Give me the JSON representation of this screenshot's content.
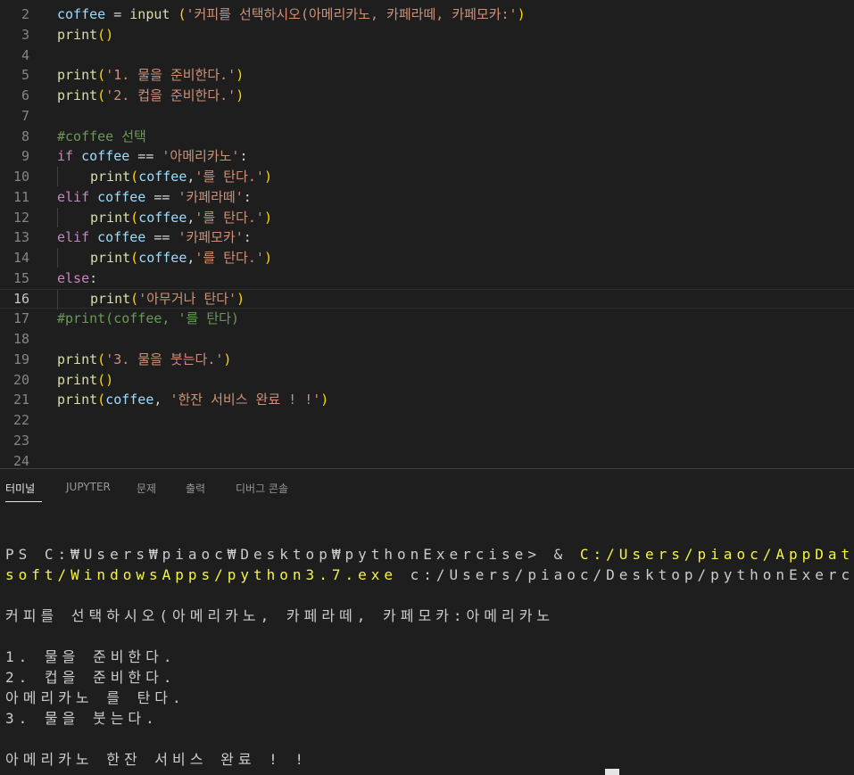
{
  "editor": {
    "lines": [
      {
        "n": "2",
        "tokens": [
          [
            "var",
            "coffee"
          ],
          [
            "pl",
            " = "
          ],
          [
            "fn",
            "input"
          ],
          [
            "pl",
            " "
          ],
          [
            "br1",
            "("
          ],
          [
            "str",
            "'커피를 선택하시오(아메리카노, 카페라떼, 카페모카:'"
          ],
          [
            "br1",
            ")"
          ]
        ]
      },
      {
        "n": "3",
        "tokens": [
          [
            "fn",
            "print"
          ],
          [
            "br1",
            "()"
          ]
        ]
      },
      {
        "n": "4",
        "tokens": []
      },
      {
        "n": "5",
        "tokens": [
          [
            "fn",
            "print"
          ],
          [
            "br1",
            "("
          ],
          [
            "str",
            "'1. 물을 준비한다.'"
          ],
          [
            "br1",
            ")"
          ]
        ]
      },
      {
        "n": "6",
        "tokens": [
          [
            "fn",
            "print"
          ],
          [
            "br1",
            "("
          ],
          [
            "str",
            "'2. 컵을 준비한다.'"
          ],
          [
            "br1",
            ")"
          ]
        ]
      },
      {
        "n": "7",
        "tokens": []
      },
      {
        "n": "8",
        "tokens": [
          [
            "cmt",
            "#coffee 선택"
          ]
        ]
      },
      {
        "n": "9",
        "tokens": [
          [
            "kw",
            "if"
          ],
          [
            "pl",
            " "
          ],
          [
            "var",
            "coffee"
          ],
          [
            "pl",
            " == "
          ],
          [
            "str",
            "'아메리카노'"
          ],
          [
            "pl",
            ":"
          ]
        ]
      },
      {
        "n": "10",
        "indent": true,
        "tokens": [
          [
            "fn",
            "print"
          ],
          [
            "br1",
            "("
          ],
          [
            "var",
            "coffee"
          ],
          [
            "pl",
            ","
          ],
          [
            "str",
            "'를 탄다.'"
          ],
          [
            "br1",
            ")"
          ]
        ]
      },
      {
        "n": "11",
        "tokens": [
          [
            "kw",
            "elif"
          ],
          [
            "pl",
            " "
          ],
          [
            "var",
            "coffee"
          ],
          [
            "pl",
            " == "
          ],
          [
            "str",
            "'카페라떼'"
          ],
          [
            "pl",
            ":"
          ]
        ]
      },
      {
        "n": "12",
        "indent": true,
        "tokens": [
          [
            "fn",
            "print"
          ],
          [
            "br1",
            "("
          ],
          [
            "var",
            "coffee"
          ],
          [
            "pl",
            ","
          ],
          [
            "str",
            "'를 탄다.'"
          ],
          [
            "br1",
            ")"
          ]
        ]
      },
      {
        "n": "13",
        "tokens": [
          [
            "kw",
            "elif"
          ],
          [
            "pl",
            " "
          ],
          [
            "var",
            "coffee"
          ],
          [
            "pl",
            " == "
          ],
          [
            "str",
            "'카페모카'"
          ],
          [
            "pl",
            ":"
          ]
        ]
      },
      {
        "n": "14",
        "indent": true,
        "tokens": [
          [
            "fn",
            "print"
          ],
          [
            "br1",
            "("
          ],
          [
            "var",
            "coffee"
          ],
          [
            "pl",
            ","
          ],
          [
            "str",
            "'를 탄다.'"
          ],
          [
            "br1",
            ")"
          ]
        ]
      },
      {
        "n": "15",
        "tokens": [
          [
            "kw",
            "else"
          ],
          [
            "pl",
            ":"
          ]
        ]
      },
      {
        "n": "16",
        "indent": true,
        "current": true,
        "tokens": [
          [
            "fn",
            "print"
          ],
          [
            "br1",
            "("
          ],
          [
            "str",
            "'아무거나 탄다'"
          ],
          [
            "br1",
            ")"
          ]
        ]
      },
      {
        "n": "17",
        "tokens": [
          [
            "cmt",
            "#print(coffee, '를 탄다)"
          ]
        ]
      },
      {
        "n": "18",
        "tokens": []
      },
      {
        "n": "19",
        "tokens": [
          [
            "fn",
            "print"
          ],
          [
            "br1",
            "("
          ],
          [
            "str",
            "'3. 물을 붓는다.'"
          ],
          [
            "br1",
            ")"
          ]
        ]
      },
      {
        "n": "20",
        "tokens": [
          [
            "fn",
            "print"
          ],
          [
            "br1",
            "()"
          ]
        ]
      },
      {
        "n": "21",
        "tokens": [
          [
            "fn",
            "print"
          ],
          [
            "br1",
            "("
          ],
          [
            "var",
            "coffee"
          ],
          [
            "pl",
            ", "
          ],
          [
            "str",
            "'한잔 서비스 완료 ! !'"
          ],
          [
            "br1",
            ")"
          ]
        ]
      },
      {
        "n": "22",
        "tokens": []
      },
      {
        "n": "23",
        "tokens": []
      },
      {
        "n": "24",
        "tokens": []
      }
    ]
  },
  "panel": {
    "tabs": [
      {
        "label": "터미널",
        "active": true
      },
      {
        "label": "JUPYTER",
        "active": false
      },
      {
        "label": "문제",
        "active": false
      },
      {
        "label": "출력",
        "active": false
      },
      {
        "label": "디버그 콘솔",
        "active": false
      }
    ]
  },
  "terminal": {
    "lines": [
      [
        [
          "plain",
          "PS C:₩Users₩piaoc₩Desktop₩pythonExercise> & "
        ],
        [
          "yellow",
          "C:/Users/piaoc/AppData/Local/Micro"
        ]
      ],
      [
        [
          "yellow",
          "soft/WindowsApps/python3.7.exe"
        ],
        [
          "plain",
          " c:/Users/piaoc/Desktop/pythonExercise/coffee.py"
        ]
      ],
      [],
      [
        [
          "plain",
          "커피를 선택하시오(아메리카노, 카페라떼, 카페모카:아메리카노"
        ]
      ],
      [],
      [
        [
          "plain",
          "1. 물을 준비한다."
        ]
      ],
      [
        [
          "plain",
          "2. 컵을 준비한다."
        ]
      ],
      [
        [
          "plain",
          "아메리카노 를 탄다."
        ]
      ],
      [
        [
          "plain",
          "3. 물을 붓는다."
        ]
      ],
      [],
      [
        [
          "plain",
          "아메리카노 한잔 서비스 완료 ! !"
        ]
      ]
    ]
  },
  "colors": {
    "editor_bg": "#1e1e1e",
    "function": "#dcdcaa",
    "keyword": "#c586c0",
    "variable": "#9cdcfe",
    "string": "#ce9178",
    "comment": "#6a9955",
    "bracket": "#ffd700",
    "terminal_yellow": "#f5f543"
  }
}
